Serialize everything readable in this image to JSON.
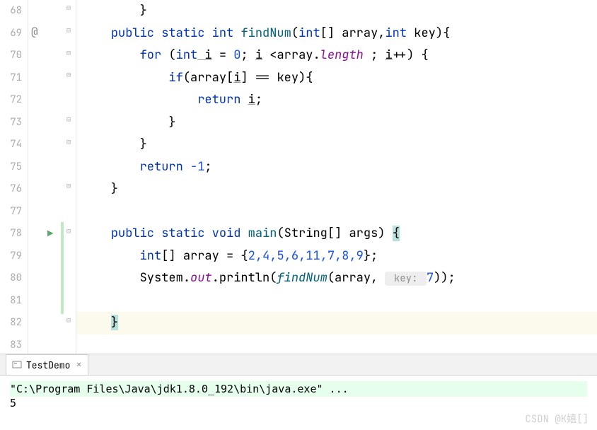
{
  "gutter_lines": [
    "68",
    "69",
    "70",
    "71",
    "72",
    "73",
    "74",
    "75",
    "76",
    "77",
    "78",
    "79",
    "80",
    "81",
    "82",
    "83"
  ],
  "code": {
    "line68": "        }",
    "line69": {
      "kw_public": "public",
      "kw_static": "static",
      "type_int": "int",
      "method_name": "findNum",
      "param_open": "(",
      "type_int2": "int",
      "brackets": "[] ",
      "param_array": "array",
      "comma": ",",
      "type_int3": "int",
      "param_key": " key",
      "param_close": ")",
      "brace": "{"
    },
    "line70": {
      "kw_for": "for",
      "open": " (",
      "type_int": "int",
      "var": " i",
      "eq": " = ",
      "zero": "0",
      "semi1": "; ",
      "var2": "i",
      "lt": " <",
      "arr": "array",
      "dot": ".",
      "length": "length",
      "semi2": " ; ",
      "var3": "i",
      "inc": "++",
      "close": ") {"
    },
    "line71": {
      "kw_if": "if",
      "open": "(",
      "arr": "array",
      "bracket_open": "[",
      "var": "i",
      "bracket_close": "]",
      "eq": " == ",
      "key": "key",
      "close": "){"
    },
    "line72": {
      "kw_return": "return",
      "sp": " ",
      "var": "i",
      "semi": ";"
    },
    "line73": "            }",
    "line74": "        }",
    "line75": {
      "kw_return": "return",
      "sp": " ",
      "val": "-1",
      "semi": ";"
    },
    "line76": "    }",
    "line78": {
      "kw_public": "public",
      "kw_static": "static",
      "kw_void": "void",
      "method_name": "main",
      "open": "(",
      "type_string": "String",
      "brackets": "[] ",
      "param_args": "args",
      "close": ") ",
      "brace": "{"
    },
    "line79": {
      "type_int": "int",
      "brackets": "[] ",
      "var": "array",
      "eq": " = {",
      "vals": "2,4,5,6,11,7,8,9",
      "close": "};"
    },
    "line80": {
      "system": "System",
      "dot1": ".",
      "out": "out",
      "dot2": ".",
      "println": "println",
      "open": "(",
      "findnum": "findNum",
      "open2": "(",
      "arr": "array",
      "comma": ", ",
      "hint": " key: ",
      "val": "7",
      "close": "));"
    },
    "line82": "}"
  },
  "console": {
    "tab_name": "TestDemo",
    "command": "\"C:\\Program Files\\Java\\jdk1.8.0_192\\bin\\java.exe\" ...",
    "output": "5"
  },
  "watermark": "CSDN @K嬉[]"
}
